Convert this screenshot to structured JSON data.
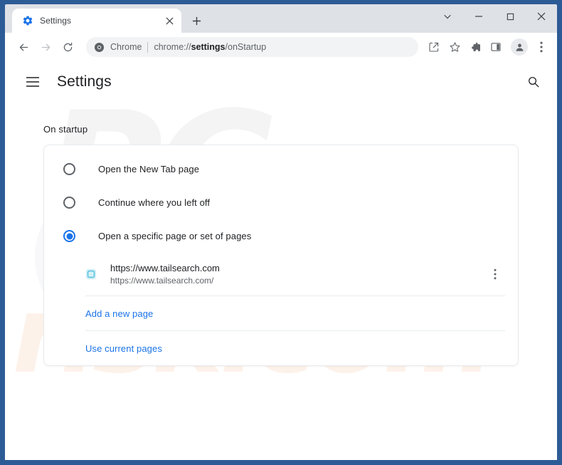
{
  "window": {
    "frame_color": "#2d5b96",
    "controls": [
      {
        "name": "tab-search-button",
        "icon": "chevron-down-icon"
      },
      {
        "name": "minimize-button",
        "icon": "minimize-icon"
      },
      {
        "name": "maximize-button",
        "icon": "maximize-icon"
      },
      {
        "name": "close-button",
        "icon": "close-icon"
      }
    ]
  },
  "tabstrip": {
    "tab": {
      "title": "Settings",
      "favicon": "settings-gear-icon",
      "close_icon": "close-icon"
    },
    "new_tab_label": "+",
    "new_tab_icon": "plus-icon"
  },
  "toolbar": {
    "back_icon": "arrow-left-icon",
    "forward_icon": "arrow-right-icon",
    "reload_icon": "reload-icon",
    "omnibox": {
      "site_icon": "chrome-logo-icon",
      "brand": "Chrome",
      "url_prefix": "chrome://",
      "url_bold": "settings",
      "url_suffix": "/onStartup",
      "full_url": "chrome://settings/onStartup"
    },
    "actions": [
      {
        "name": "share-icon"
      },
      {
        "name": "bookmark-star-icon"
      },
      {
        "name": "extensions-puzzle-icon"
      },
      {
        "name": "side-panel-icon"
      },
      {
        "name": "profile-avatar-icon"
      },
      {
        "name": "chrome-menu-dots-icon"
      }
    ]
  },
  "settings_page": {
    "menu_icon": "hamburger-menu-icon",
    "title": "Settings",
    "search_icon": "search-icon",
    "section_label": "On startup",
    "startup_options": [
      {
        "label": "Open the New Tab page",
        "checked": false
      },
      {
        "label": "Continue where you left off",
        "checked": false
      },
      {
        "label": "Open a specific page or set of pages",
        "checked": true
      }
    ],
    "startup_pages": [
      {
        "title": "https://www.tailsearch.com",
        "url": "https://www.tailsearch.com/",
        "favicon": "tailsearch-favicon",
        "favicon_color": "#7cd3e8",
        "menu_icon": "more-vertical-icon"
      }
    ],
    "add_page_label": "Add a new page",
    "use_current_label": "Use current pages",
    "accent_color": "#1a73e8"
  },
  "watermark": {
    "logo_text": "PC",
    "site_text": "risk.com"
  }
}
